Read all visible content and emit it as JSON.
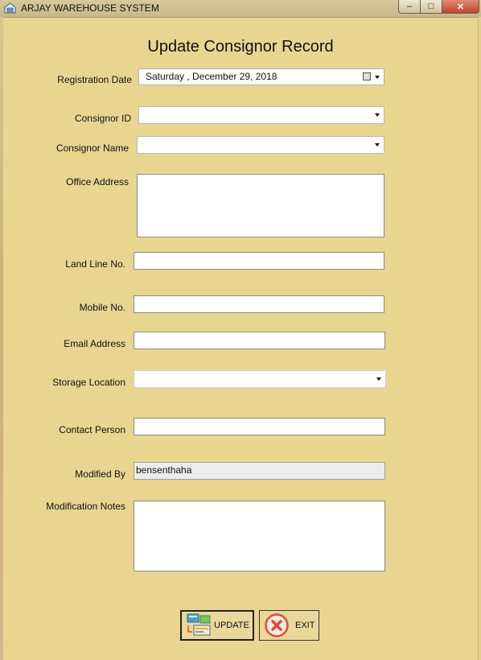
{
  "window": {
    "title": "ARJAY WAREHOUSE SYSTEM",
    "min_glyph": "–",
    "max_glyph": "□",
    "close_glyph": "✕"
  },
  "form": {
    "heading": "Update Consignor Record",
    "registration_date_label": "Registration Date",
    "registration_date_value": "Saturday   , December  29, 2018",
    "consignor_id_label": "Consignor ID",
    "consignor_id_value": "",
    "consignor_name_label": "Consignor Name",
    "consignor_name_value": "",
    "office_address_label": "Office Address",
    "office_address_value": "",
    "landline_label": "Land Line No.",
    "landline_value": "",
    "mobile_label": "Mobile No.",
    "mobile_value": "",
    "email_label": "Email Address",
    "email_value": "",
    "storage_location_label": "Storage Location",
    "storage_location_value": "",
    "contact_person_label": "Contact Person",
    "contact_person_value": "",
    "modified_by_label": "Modified By",
    "modified_by_value": "bensenthaha",
    "modification_notes_label": "Modification Notes",
    "modification_notes_value": ""
  },
  "buttons": {
    "update_label": "UPDATE",
    "exit_label": "EXIT",
    "update_icon": "update-records-icon",
    "exit_icon": "exit-x-icon"
  }
}
